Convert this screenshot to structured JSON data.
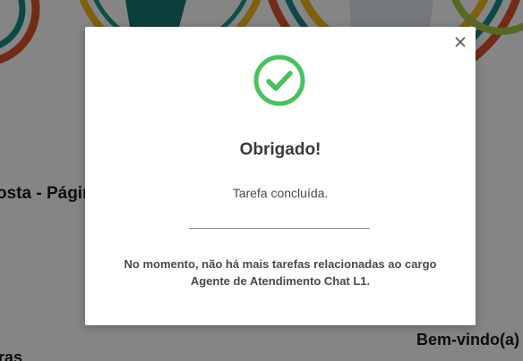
{
  "background": {
    "heading": "osta - Págin",
    "welcome": "Bem-vindo(a)",
    "partial_text": "ras"
  },
  "modal": {
    "title": "Obrigado!",
    "subtitle": "Tarefa concluída.",
    "message_line1": "No momento, não há mais tarefas relacionadas ao cargo",
    "message_line2": "Agente de Atendimento Chat L1.",
    "success_icon": "check-circle-icon",
    "close_icon": "close-icon"
  },
  "colors": {
    "success_green": "#4cbf5f",
    "overlay": "rgba(0,0,0,0.48)"
  }
}
